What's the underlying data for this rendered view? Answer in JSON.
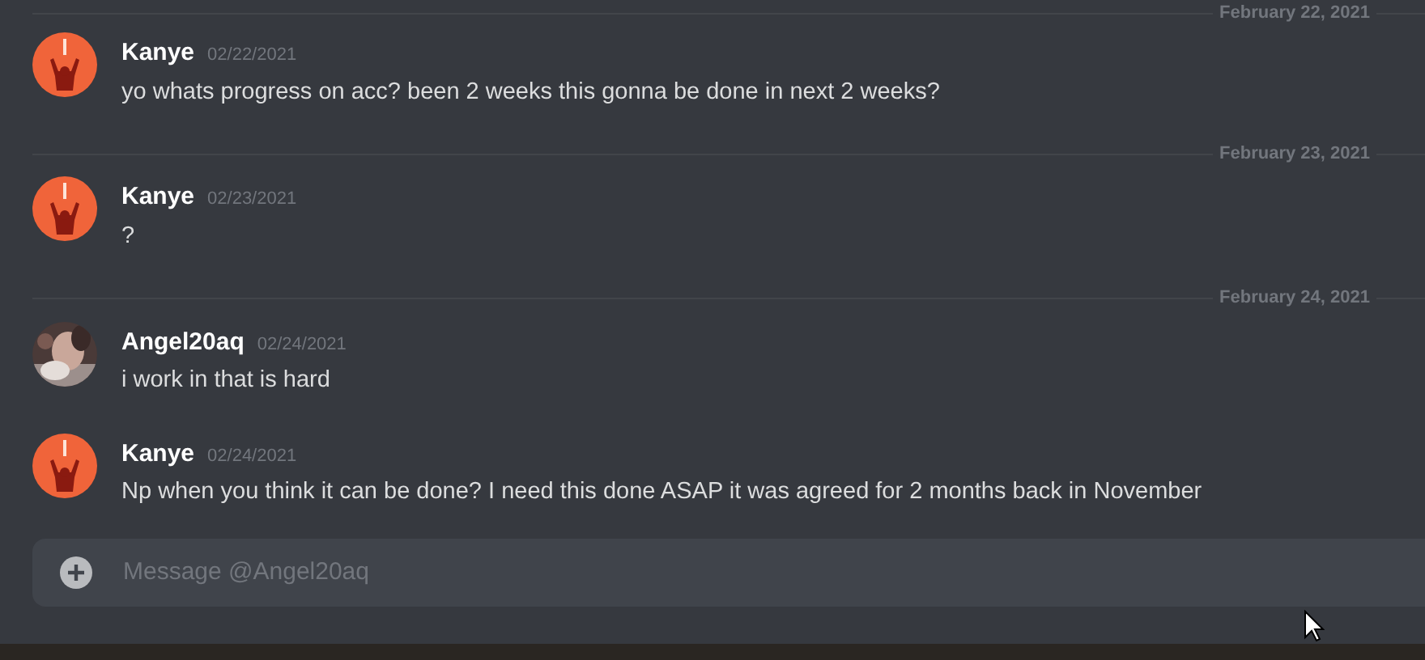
{
  "timeline": [
    {
      "kind": "divider",
      "date": "February 22, 2021"
    },
    {
      "kind": "message",
      "author": "Kanye",
      "timestamp": "02/22/2021",
      "text": "yo whats progress on acc? been 2 weeks this gonna be done in next 2 weeks?",
      "avatar": {
        "kind": "illustration"
      }
    },
    {
      "kind": "divider",
      "date": "February 23, 2021"
    },
    {
      "kind": "message",
      "author": "Kanye",
      "timestamp": "02/23/2021",
      "text": "?",
      "avatar": {
        "kind": "illustration"
      }
    },
    {
      "kind": "divider",
      "date": "February 24, 2021"
    },
    {
      "kind": "message",
      "author": "Angel20aq",
      "timestamp": "02/24/2021",
      "text": "i work in that is hard"
    },
    {
      "kind": "message",
      "author": "Kanye",
      "timestamp": "02/24/2021",
      "text": "Np when you think it can be done? I need this done ASAP it was agreed for 2 months back in November",
      "avatar": {
        "kind": "illustration"
      }
    }
  ],
  "composer": {
    "placeholder": "Message @Angel20aq"
  }
}
